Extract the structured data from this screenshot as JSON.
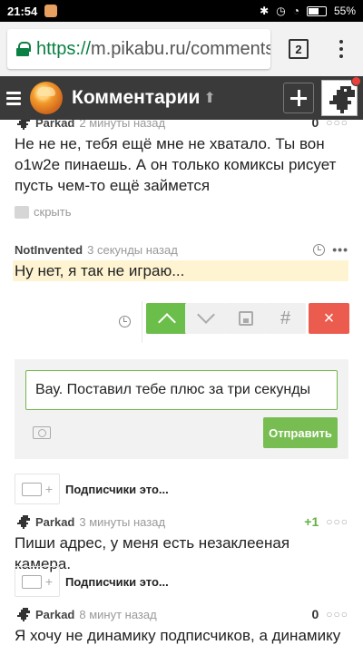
{
  "statusbar": {
    "time": "21:54",
    "battery": "55%"
  },
  "browser": {
    "url_scheme": "https://",
    "url_rest": "m.pikabu.ru/comments",
    "tab_count": "2"
  },
  "header": {
    "title": "Комментарии"
  },
  "comments": [
    {
      "user": "Parkad",
      "time": "2 минуты назад",
      "rating": "0",
      "text": "Не не не, тебя ещё мне не хватало. Ты вон o1w2e пинаешь. А он только комиксы рисует пусть чем-то ещё займется",
      "hide_label": "скрыть"
    },
    {
      "user": "NotInvented",
      "time": "3 секунды назад",
      "text": "Ну нет, я так не играю..."
    },
    {
      "user": "Parkad",
      "time": "3 минуты назад",
      "rating": "+1",
      "text": "Пиши адрес, у меня есть незаклееная камера."
    },
    {
      "user": "Parkad",
      "time": "8 минут назад",
      "rating": "0",
      "text": "Я хочу не динамику подписчиков, а динамику"
    }
  ],
  "vote": {
    "hash": "#",
    "close": "×"
  },
  "reply": {
    "value": "Вау. Поставил тебе плюс за три секунды",
    "send_label": "Отправить"
  },
  "subs": [
    {
      "label": "Подписчики это",
      "dots": "..."
    },
    {
      "label": "Подписчики это",
      "dots": "..."
    }
  ],
  "colors": {
    "accent_green": "#6cbe4a",
    "close_red": "#ec5c4e",
    "header_bg": "#3a3a3a",
    "highlight": "#fef4d2"
  }
}
